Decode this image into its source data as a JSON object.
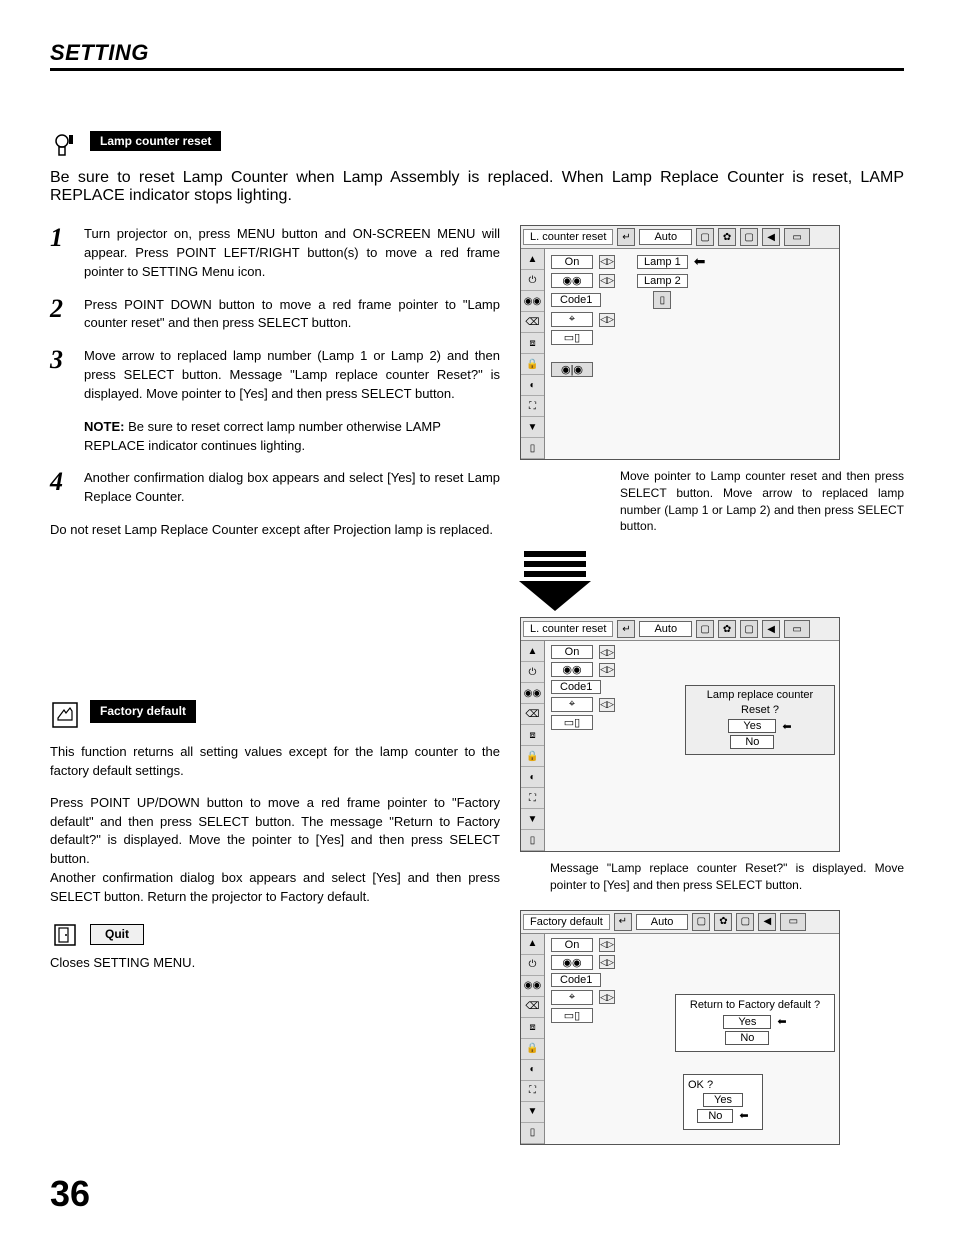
{
  "page_header": "SETTING",
  "page_number": "36",
  "lamp_section": {
    "title": "Lamp counter reset",
    "intro": "Be sure to reset Lamp Counter when Lamp Assembly is replaced.  When Lamp Replace Counter is reset, LAMP REPLACE indicator stops lighting.",
    "steps": [
      "Turn projector on, press MENU button and ON-SCREEN MENU will appear.  Press POINT LEFT/RIGHT button(s) to move a red frame pointer to SETTING Menu icon.",
      "Press POINT DOWN button to move a red frame pointer to \"Lamp counter reset\" and then press SELECT button.",
      "Move arrow to replaced lamp number (Lamp 1 or Lamp 2) and then press SELECT button.  Message \"Lamp replace counter Reset?\" is displayed. Move pointer to [Yes] and then press SELECT button.",
      "Another confirmation dialog box appears and select [Yes] to reset Lamp Replace Counter."
    ],
    "note_label": "NOTE:",
    "note_body": "Be sure to reset correct lamp number otherwise LAMP REPLACE indicator continues lighting.",
    "final": "Do not reset Lamp Replace Counter except after Projection lamp is replaced."
  },
  "factory_section": {
    "title": "Factory default",
    "body1": "This function returns all setting values except for the lamp counter to the factory default settings.",
    "body2": "Press POINT UP/DOWN button to move a red frame pointer to \"Factory default\" and then press SELECT button.  The message \"Return to Factory default?\" is displayed.  Move the pointer to [Yes] and then press SELECT button.",
    "body3": "Another confirmation dialog box appears and select [Yes] and then press SELECT button. Return the projector to Factory default."
  },
  "quit": {
    "label": "Quit",
    "desc": "Closes SETTING MENU."
  },
  "osd1": {
    "title": "L. counter reset",
    "auto": "Auto",
    "rows": {
      "on": "On",
      "code": "Code1"
    },
    "lamp1": "Lamp 1",
    "lamp2": "Lamp 2",
    "annot": "Move pointer to Lamp counter reset and then press SELECT button. Move arrow to replaced lamp number (Lamp 1 or Lamp 2) and then press SELECT button."
  },
  "osd2": {
    "title": "L. counter reset",
    "auto": "Auto",
    "rows": {
      "on": "On",
      "code": "Code1"
    },
    "dialog_title1": "Lamp replace counter",
    "dialog_title2": "Reset ?",
    "yes": "Yes",
    "no": "No",
    "annot": "Message \"Lamp replace counter Reset?\" is displayed. Move pointer to [Yes] and then press SELECT button."
  },
  "osd3": {
    "title": "Factory default",
    "auto": "Auto",
    "rows": {
      "on": "On",
      "code": "Code1"
    },
    "dialog_title": "Return to Factory default ?",
    "ok": "OK ?",
    "yes": "Yes",
    "no": "No"
  }
}
